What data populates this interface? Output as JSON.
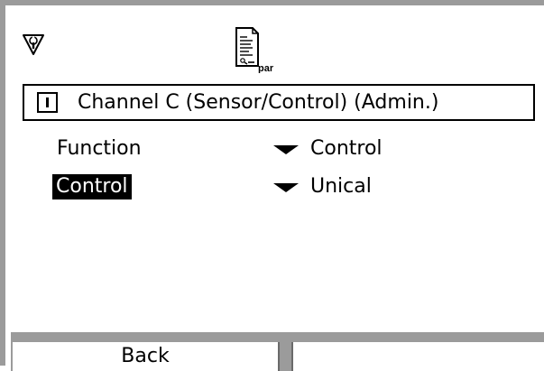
{
  "icons": {
    "status": "wrench-shield-icon",
    "mode": "parameter-document-icon",
    "mode_subscript": "par",
    "channel": "channel-module-icon"
  },
  "header": {
    "title": "Channel C (Sensor/Control) (Admin.)"
  },
  "rows": [
    {
      "label": "Function",
      "value": "Control",
      "selected": false
    },
    {
      "label": "Control",
      "value": "Unical",
      "selected": true
    }
  ],
  "softkeys": {
    "left": "Back",
    "right": ""
  },
  "colors": {
    "frame": "#9b9b9b",
    "highlight_bg": "#000000",
    "highlight_fg": "#ffffff"
  }
}
